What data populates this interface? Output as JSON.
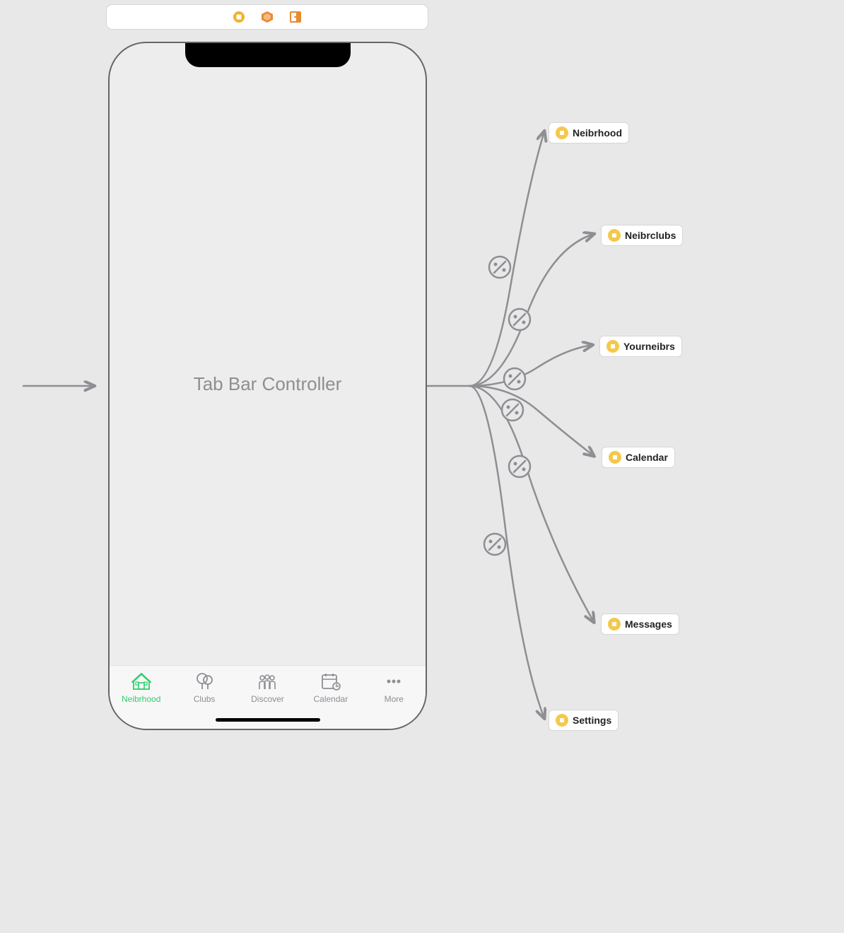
{
  "screen": {
    "title": "Tab Bar Controller"
  },
  "toolbar": {
    "icons": [
      "scene-icon",
      "object-icon",
      "exit-icon"
    ]
  },
  "tabs": [
    {
      "label": "Neibrhood",
      "icon": "house-icon",
      "active": true
    },
    {
      "label": "Clubs",
      "icon": "clubs-icon",
      "active": false
    },
    {
      "label": "Discover",
      "icon": "people-icon",
      "active": false
    },
    {
      "label": "Calendar",
      "icon": "calendar-icon",
      "active": false
    },
    {
      "label": "More",
      "icon": "more-icon",
      "active": false
    }
  ],
  "destinations": [
    {
      "label": "Neibrhood"
    },
    {
      "label": "Neibrclubs"
    },
    {
      "label": "Yourneibrs"
    },
    {
      "label": "Calendar"
    },
    {
      "label": "Messages"
    },
    {
      "label": "Settings"
    }
  ],
  "colors": {
    "active": "#2ecf6b",
    "inactive": "#8e8e93",
    "node_icon": "#f5c84b",
    "toolbar_gold": "#f2b22e",
    "toolbar_orange": "#ea8a2f"
  }
}
